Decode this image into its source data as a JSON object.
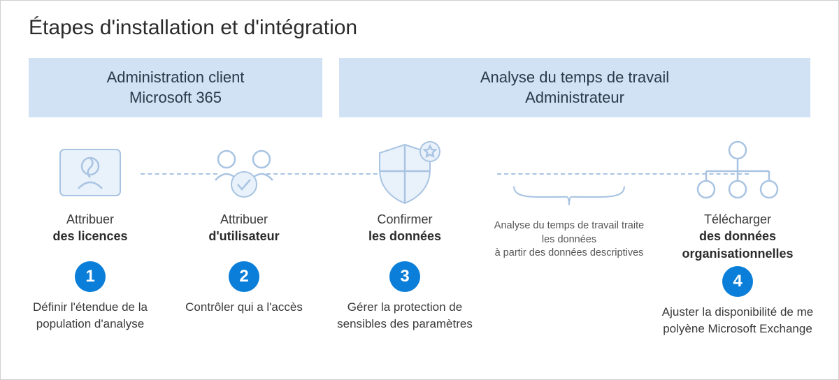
{
  "title": "Étapes d'installation et d'intégration",
  "bands": {
    "left": {
      "line1": "Administration client",
      "line2": "Microsoft 365"
    },
    "right": {
      "line1": "Analyse du temps de travail",
      "line2": "Administrateur"
    }
  },
  "steps": {
    "s1": {
      "title_l1": "Attribuer",
      "title_l2": "des licences",
      "num": "1",
      "desc": "Définir l'étendue de la population d'analyse"
    },
    "s2": {
      "title_l1": "Attribuer",
      "title_l2": "d'utilisateur",
      "num": "2",
      "desc": "Contrôler qui a l'accès"
    },
    "s3": {
      "title_l1": "Confirmer",
      "title_l2": "les données",
      "num": "3",
      "desc": "Gérer la protection de sensibles des paramètres"
    },
    "mid": {
      "note_l1": "Analyse du temps de travail traite les données",
      "note_l2": "à partir des données descriptives"
    },
    "s4": {
      "title_l1": "Télécharger",
      "title_l2": "des données organisationnelles",
      "num": "4",
      "desc": "Ajuster la disponibilité de me polyène Microsoft Exchange"
    }
  }
}
